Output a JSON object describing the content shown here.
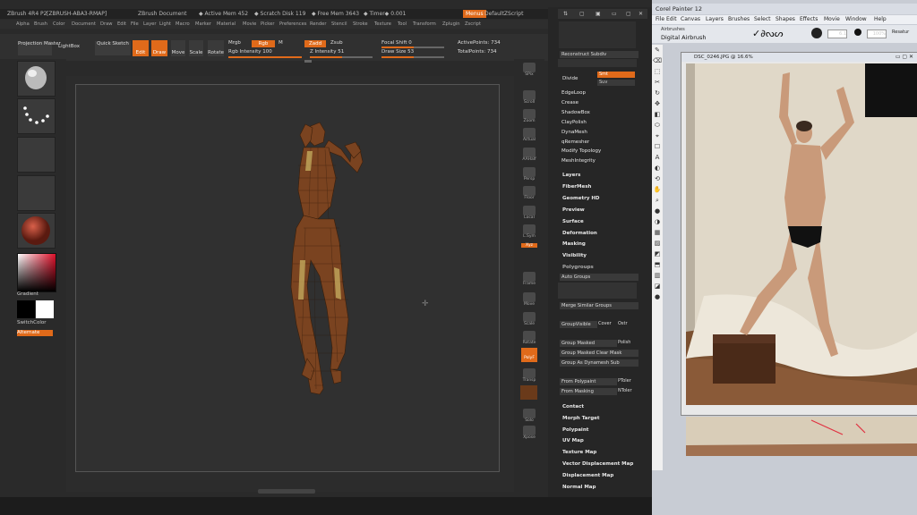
{
  "zbrush": {
    "title_items": [
      "ZBrush 4R4 P2",
      "[ZBRUSH-ABA3-RMAP]",
      "ZBrush Document",
      "◆ Active Mem 452",
      "◆ Scratch Disk 119",
      "◆ Free Mem 3643",
      "◆ Timer◆ 0.001"
    ],
    "menu_right_btn": "Menus",
    "default_script": "DefaultZScript",
    "menu_items": [
      "Alpha",
      "Brush",
      "Color",
      "Document",
      "Draw",
      "Edit",
      "File",
      "Layer",
      "Light",
      "Macro",
      "Marker",
      "Material",
      "Movie",
      "Picker",
      "Preferences",
      "Render",
      "Stencil",
      "Stroke",
      "Texture",
      "Tool",
      "Transform",
      "Zplugin",
      "Zscript"
    ],
    "toolbar": {
      "projection_master": "Projection Master",
      "lightbox": "LightBox",
      "quick_sketch": "Quick Sketch",
      "edit": "Edit",
      "draw": "Draw",
      "move": "Move",
      "scale": "Scale",
      "rotate": "Rotate",
      "mrgb": "Mrgb",
      "rgb": "Rgb",
      "m": "M",
      "rgb_intensity": "Rgb Intensity 100",
      "zadd": "Zadd",
      "zsub": "Zsub",
      "z_intensity": "Z Intensity 51",
      "focal_shift": "Focal Shift 0",
      "draw_size": "Draw Size 53",
      "active_points": "ActivePoints: 734",
      "total_points": "TotalPoints: 734"
    },
    "left_shelf": {
      "gradient": "Gradient",
      "switch_color": "SwitchColor",
      "alternate": "Alternate"
    },
    "right_shelf": [
      "SPix",
      "Scroll",
      "Zoom",
      "Actual",
      "AAHalf",
      "Persp",
      "Floor",
      "Local",
      "L.Sym",
      "Xyz",
      "Frame",
      "Move",
      "Scale",
      "Rotate",
      "PolyF",
      "Transp",
      "Solo",
      "Xpose"
    ],
    "tray_top": [
      "Reconstruct Subdiv",
      "Divide",
      "EdgeLoop",
      "Crease",
      "ShadowBox",
      "ClayPolish",
      "DynaMesh",
      "qRemesher",
      "Modify Topology",
      "MeshIntegrity"
    ],
    "divide_smt": "Smt",
    "divide_suv": "Suv",
    "tray_main": [
      "Layers",
      "FiberMesh",
      "Geometry HD",
      "Preview",
      "Surface",
      "Deformation",
      "Masking",
      "Visibility"
    ],
    "polygroups_header": "Polygroups",
    "polygroups": [
      "Auto Groups",
      "Merge Similar Groups",
      "GroupVisible",
      "Group Masked",
      "Group Masked Clear Mask",
      "Group As Dynamesh Sub",
      "From Polypaint",
      "From Masking"
    ],
    "polygroup_opts": {
      "coverage": "Cover",
      "ostr": "Ostr",
      "polish": "Polish",
      "ptoler": "PToler",
      "ntoler": "NToler"
    },
    "tray_bottom": [
      "Contact",
      "Morph Target",
      "Polypaint",
      "UV Map",
      "Texture Map",
      "Vector Displacement Map",
      "Displacement Map",
      "Normal Map"
    ]
  },
  "painter": {
    "title": "Corel Painter 12",
    "menu": [
      "File",
      "Edit",
      "Canvas",
      "Layers",
      "Brushes",
      "Select",
      "Shapes",
      "Effects",
      "Movie",
      "Window",
      "Help"
    ],
    "brush_category": "Airbrushes",
    "brush_variant": "Digital Airbrush",
    "size_value": "6.1",
    "opacity_value": "100%",
    "resat_label": "Resatur",
    "document_title": "DSC_0246.JPG @ 16.6%"
  },
  "colors": {
    "accent": "#e06a1a",
    "zb_bg": "#2a2a2a",
    "painter_bg": "#c8ccd4"
  }
}
